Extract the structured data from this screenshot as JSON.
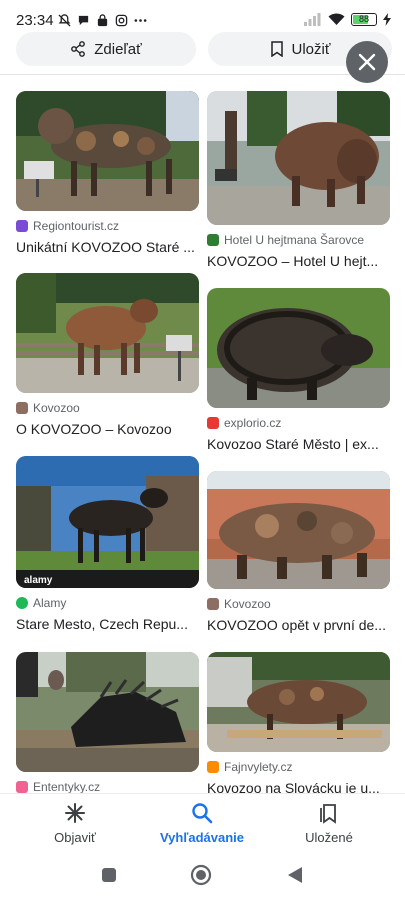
{
  "status_bar": {
    "time": "23:34",
    "battery": "88"
  },
  "actions": {
    "share_label": "Zdieľať",
    "save_label": "Uložiť"
  },
  "results": [
    {
      "source": "Regiontourist.cz",
      "title": "Unikátní KOVOZOO Staré ...",
      "favicon_color": "#7b4bd6"
    },
    {
      "source": "Hotel U hejtmana Šarovce",
      "title": "KOVOZOO – Hotel U hejt...",
      "favicon_color": "#2e7d32"
    },
    {
      "source": "Kovozoo",
      "title": "O KOVOZOO – Kovozoo",
      "favicon_color": "#8d6e63"
    },
    {
      "source": "explorio.cz",
      "title": "Kovozoo Staré Město | ex...",
      "favicon_color": "#e53935"
    },
    {
      "source": "Alamy",
      "title": "Stare Mesto, Czech Repu...",
      "favicon_color": "#1db954"
    },
    {
      "source": "Kovozoo",
      "title": "KOVOZOO opět v první de...",
      "favicon_color": "#8d6e63"
    },
    {
      "source": "Ententyky.cz",
      "title": "",
      "favicon_color": "#f06292"
    },
    {
      "source": "Fajnvylety.cz",
      "title": "Kovozoo na Slovácku je u...",
      "favicon_color": "#fb8c00"
    }
  ],
  "image_watermark": "alamy",
  "bottom_nav": {
    "explore": "Objaviť",
    "search": "Vyhľadávanie",
    "saved": "Uložené"
  },
  "colors": {
    "accent": "#1a73e8",
    "close_button": "#5f6368"
  }
}
